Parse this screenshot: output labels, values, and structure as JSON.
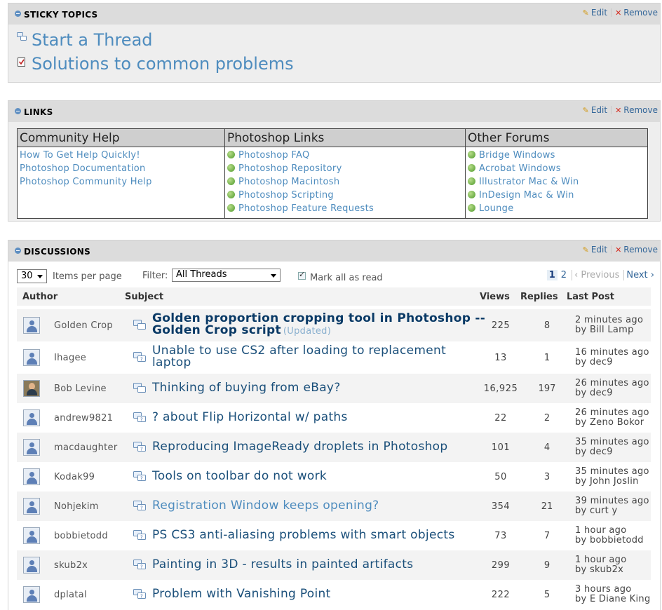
{
  "sticky": {
    "title": "STICKY TOPICS",
    "edit": "Edit",
    "remove": "Remove",
    "items": [
      {
        "label": "Start a Thread",
        "icon": "discussion-icon"
      },
      {
        "label": "Solutions to common problems",
        "icon": "checklist-icon"
      }
    ]
  },
  "links": {
    "title": "LINKS",
    "edit": "Edit",
    "remove": "Remove",
    "columns": [
      {
        "header": "Community Help",
        "items": [
          "How To Get Help Quickly!",
          "Photoshop Documentation",
          "Photoshop Community Help"
        ]
      },
      {
        "header": "Photoshop Links",
        "items": [
          "Photoshop FAQ",
          "Photoshop Repository",
          "Photoshop Macintosh",
          "Photoshop Scripting",
          "Photoshop Feature Requests"
        ]
      },
      {
        "header": "Other Forums",
        "items": [
          "Bridge Windows",
          "Acrobat Windows",
          "Illustrator Mac & Win",
          "InDesign Mac & Win",
          "Lounge"
        ]
      }
    ]
  },
  "discussions": {
    "title": "DISCUSSIONS",
    "edit": "Edit",
    "remove": "Remove",
    "per_page_value": "30",
    "per_page_label": "Items per page",
    "filter_label": "Filter:",
    "filter_value": "All Threads",
    "mark_read_label": "Mark all as read",
    "pager": {
      "current": "1",
      "next_page": "2",
      "previous": "Previous",
      "next": "Next"
    },
    "columns": {
      "author": "Author",
      "subject": "Subject",
      "views": "Views",
      "replies": "Replies",
      "last_post": "Last Post"
    },
    "rows": [
      {
        "author": "Golden Crop",
        "subject": "Golden proportion cropping tool in Photoshop -- Golden Crop script",
        "tag": "(Updated)",
        "views": "225",
        "replies": "8",
        "time": "2 minutes ago",
        "by": "by Bill Lamp"
      },
      {
        "author": "Ihagee",
        "subject": "Unable to use CS2 after loading to replacement laptop",
        "views": "13",
        "replies": "1",
        "time": "16 minutes ago",
        "by": "by dec9"
      },
      {
        "author": "Bob Levine",
        "subject": "Thinking of buying from eBay?",
        "views": "16,925",
        "replies": "197",
        "time": "26 minutes ago",
        "by": "by dec9"
      },
      {
        "author": "andrew9821",
        "subject": "? about Flip Horizontal w/ paths",
        "views": "22",
        "replies": "2",
        "time": "26 minutes ago",
        "by": "by Zeno Bokor"
      },
      {
        "author": "macdaughter",
        "subject": "Reproducing ImageReady droplets in Photoshop",
        "views": "101",
        "replies": "4",
        "time": "35 minutes ago",
        "by": "by dec9"
      },
      {
        "author": "Kodak99",
        "subject": "Tools on toolbar do not work",
        "views": "50",
        "replies": "3",
        "time": "35 minutes ago",
        "by": "by John Joslin"
      },
      {
        "author": "Nohjekim",
        "subject": "Registration Window keeps opening?",
        "views": "354",
        "replies": "21",
        "time": "39 minutes ago",
        "by": "by curt y"
      },
      {
        "author": "bobbietodd",
        "subject": "PS CS3 anti-aliasing problems with smart objects",
        "views": "73",
        "replies": "7",
        "time": "1 hour ago",
        "by": "by bobbietodd"
      },
      {
        "author": "skub2x",
        "subject": "Painting in 3D - results in painted artifacts",
        "views": "299",
        "replies": "9",
        "time": "1 hour ago",
        "by": "by skub2x"
      },
      {
        "author": "dplatal",
        "subject": "Problem with Vanishing Point",
        "views": "222",
        "replies": "5",
        "time": "3 hours ago",
        "by": "by E Diane King"
      }
    ]
  }
}
